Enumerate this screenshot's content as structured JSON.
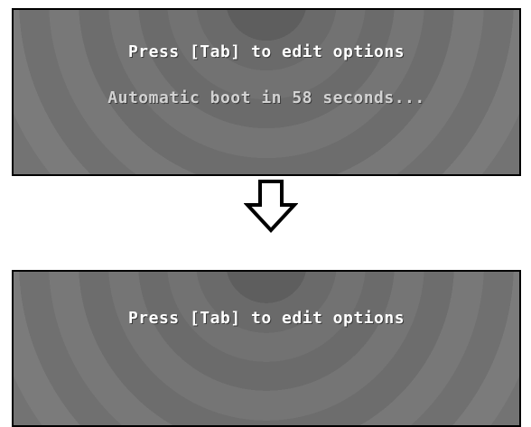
{
  "screen_before": {
    "prompt": "Press [Tab] to edit options",
    "countdown": "Automatic boot in 58 seconds..."
  },
  "screen_after": {
    "prompt": "Press [Tab] to edit options"
  },
  "transition_icon": "down-arrow-icon"
}
